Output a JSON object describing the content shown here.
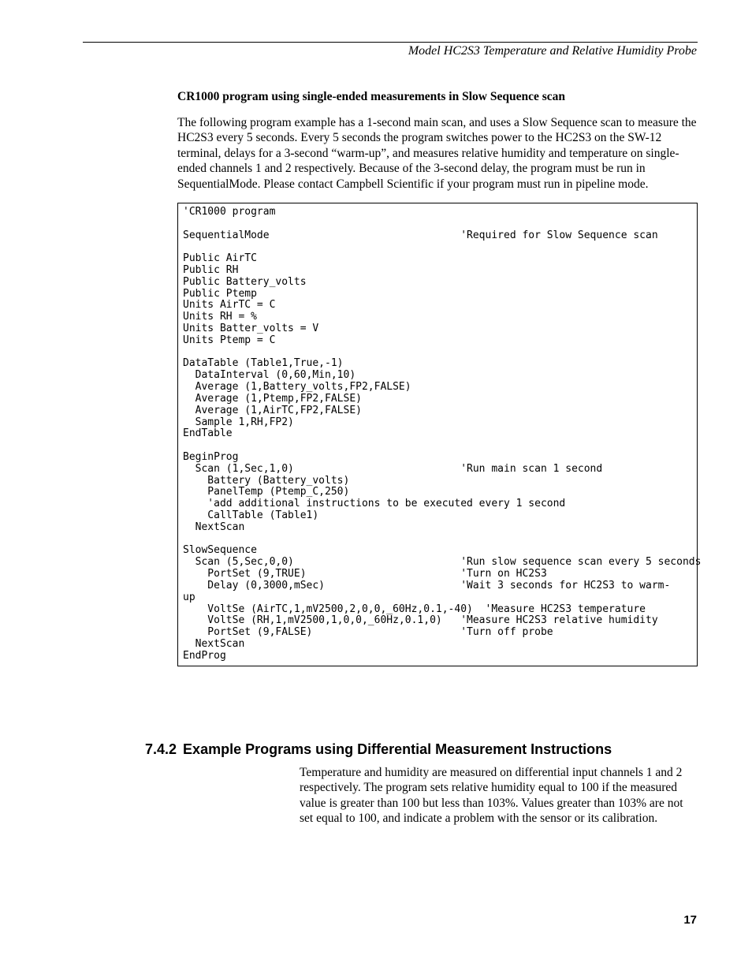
{
  "running_head": "Model HC2S3 Temperature and Relative Humidity Probe",
  "subtitle": "CR1000 program using single-ended measurements in Slow Sequence scan",
  "intro_para": "The following program example has a 1-second main scan, and uses a Slow Sequence scan to measure the HC2S3 every 5 seconds.  Every 5 seconds the program switches power to the HC2S3 on the SW-12 terminal, delays for a 3-second “warm-up”, and measures relative humidity and temperature on single-ended channels 1 and 2 respectively.  Because of the 3-second delay, the program must be run in SequentialMode.  Please contact Campbell Scientific if your program must run in pipeline mode.",
  "code": "'CR1000 program\n\nSequentialMode                               'Required for Slow Sequence scan\n\nPublic AirTC\nPublic RH\nPublic Battery_volts\nPublic Ptemp\nUnits AirTC = C\nUnits RH = %\nUnits Batter_volts = V\nUnits Ptemp = C\n\nDataTable (Table1,True,-1)\n  DataInterval (0,60,Min,10)\n  Average (1,Battery_volts,FP2,FALSE)\n  Average (1,Ptemp,FP2,FALSE)\n  Average (1,AirTC,FP2,FALSE)\n  Sample 1,RH,FP2)\nEndTable\n\nBeginProg\n  Scan (1,Sec,1,0)                           'Run main scan 1 second\n    Battery (Battery_volts)\n    PanelTemp (Ptemp_C,250)\n    'add additional instructions to be executed every 1 second\n    CallTable (Table1)\n  NextScan\n\nSlowSequence\n  Scan (5,Sec,0,0)                           'Run slow sequence scan every 5 seconds\n    PortSet (9,TRUE)                         'Turn on HC2S3\n    Delay (0,3000,mSec)                      'Wait 3 seconds for HC2S3 to warm-\nup\n    VoltSe (AirTC,1,mV2500,2,0,0,_60Hz,0.1,-40)  'Measure HC2S3 temperature\n    VoltSe (RH,1,mV2500,1,0,0,_60Hz,0.1,0)   'Measure HC2S3 relative humidity\n    PortSet (9,FALSE)                        'Turn off probe\n  NextScan\nEndProg",
  "section": {
    "number": "7.4.2",
    "title": "Example Programs using Differential Measurement Instructions",
    "body": "Temperature and humidity are measured on differential input channels 1 and 2 respectively.  The program sets relative humidity equal to 100 if the measured value is greater than 100 but less than 103%.  Values greater than 103% are not set equal to 100, and indicate a problem with the sensor or its calibration."
  },
  "page_number": "17"
}
